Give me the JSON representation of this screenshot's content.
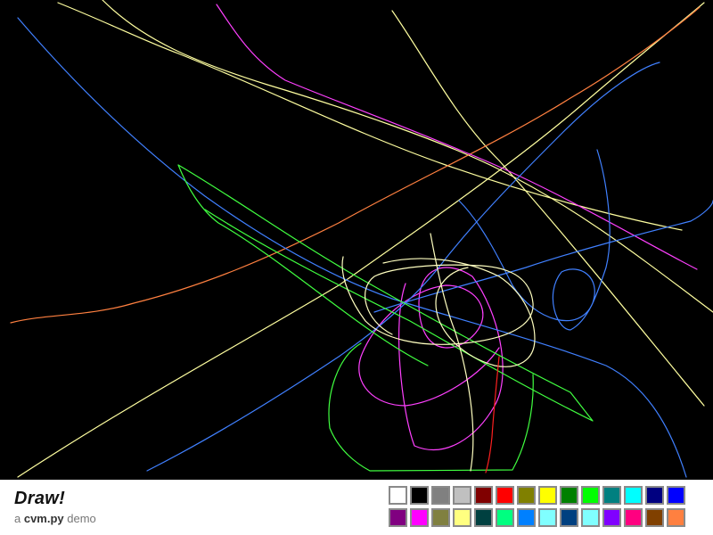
{
  "app": {
    "title": "Draw!",
    "subtitle_prefix": "a ",
    "subtitle_brand": "cvm.py",
    "subtitle_suffix": " demo"
  },
  "canvas": {
    "background": "#000000",
    "strokes": [
      {
        "color": "#FFFFA0"
      },
      {
        "color": "#FFFFA0"
      },
      {
        "color": "#FFFFA0"
      },
      {
        "color": "#FFFFA0"
      },
      {
        "color": "#FF8040"
      },
      {
        "color": "#FF40FF"
      },
      {
        "color": "#FF40FF"
      },
      {
        "color": "#4080FF"
      },
      {
        "color": "#4080FF"
      },
      {
        "color": "#4080FF"
      },
      {
        "color": "#4080FF"
      },
      {
        "color": "#40FF40"
      },
      {
        "color": "#40FF40"
      },
      {
        "color": "#40FF40"
      },
      {
        "color": "#FFFFC0"
      },
      {
        "color": "#FFFFC0"
      },
      {
        "color": "#FFFFC0"
      },
      {
        "color": "#FF2020"
      }
    ]
  },
  "palette": {
    "colors": [
      "#FFFFFF",
      "#000000",
      "#808080",
      "#C0C0C0",
      "#800000",
      "#FF0000",
      "#808000",
      "#FFFF00",
      "#008000",
      "#00FF00",
      "#008080",
      "#00FFFF",
      "#000080",
      "#0000FF",
      "#800080",
      "#FF00FF",
      "#808040",
      "#FFFF80",
      "#004040",
      "#00FF80",
      "#0080FF",
      "#80FFFF",
      "#004080",
      "#80FFFF",
      "#8000FF",
      "#FF0080",
      "#804000",
      "#FF8040"
    ]
  }
}
